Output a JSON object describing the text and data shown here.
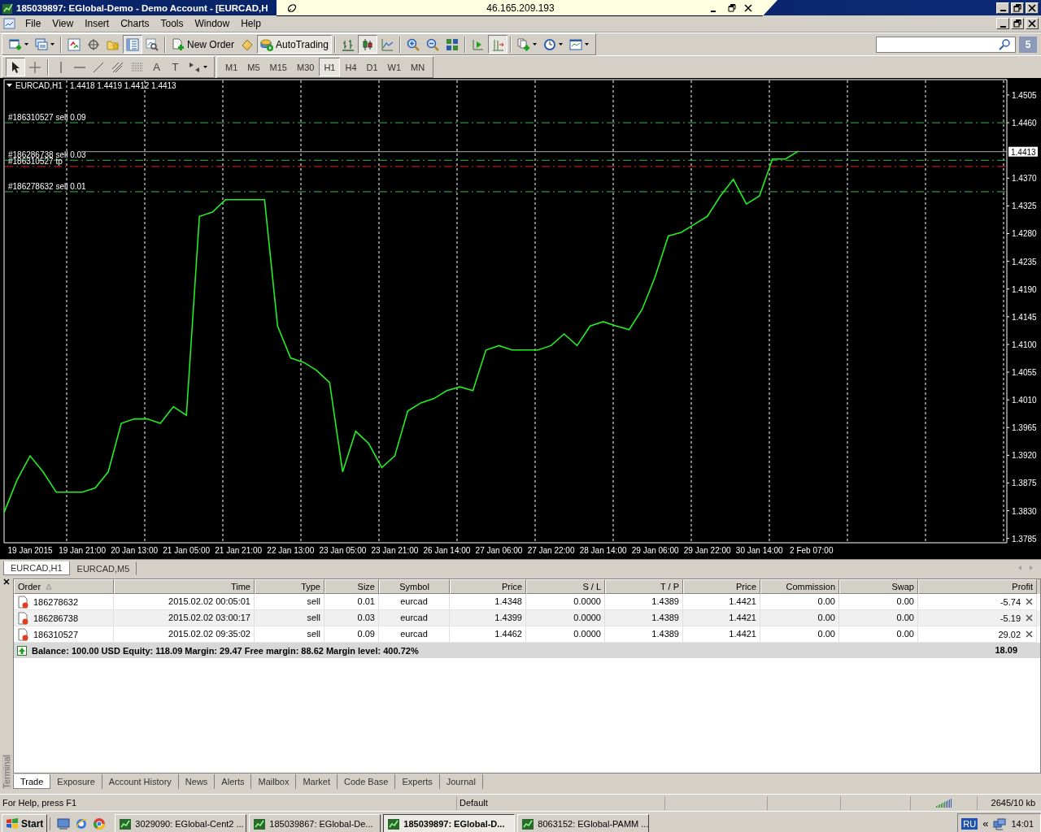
{
  "window": {
    "title": "185039897: EGlobal-Demo - Demo Account - [EURCAD,H"
  },
  "remote_bar": {
    "address": "46.165.209.193"
  },
  "menu": [
    {
      "label": "File"
    },
    {
      "label": "View"
    },
    {
      "label": "Insert"
    },
    {
      "label": "Charts"
    },
    {
      "label": "Tools"
    },
    {
      "label": "Window"
    },
    {
      "label": "Help"
    }
  ],
  "toolbar": [
    {
      "kind": "new-chart",
      "selected": false
    },
    {
      "kind": "profiles",
      "selected": false
    },
    {
      "kind": "separator"
    },
    {
      "kind": "market-watch",
      "selected": false
    },
    {
      "kind": "data-window",
      "selected": false
    },
    {
      "kind": "navigator",
      "selected": false
    },
    {
      "kind": "terminal",
      "selected": true
    },
    {
      "kind": "tester",
      "selected": false
    },
    {
      "kind": "separator"
    },
    {
      "kind": "new-order",
      "label": "New Order",
      "selected": false
    },
    {
      "kind": "metaeditor",
      "selected": false
    },
    {
      "kind": "autotrading",
      "label": "AutoTrading",
      "selected": true
    },
    {
      "kind": "separator"
    },
    {
      "kind": "bar-chart",
      "selected": false
    },
    {
      "kind": "candle-chart",
      "selected": true
    },
    {
      "kind": "line-chart",
      "selected": false
    },
    {
      "kind": "separator"
    },
    {
      "kind": "zoom-in",
      "selected": false
    },
    {
      "kind": "zoom-out",
      "selected": false
    },
    {
      "kind": "tile",
      "selected": false
    },
    {
      "kind": "separator"
    },
    {
      "kind": "autoscroll",
      "selected": false
    },
    {
      "kind": "chart-shift",
      "selected": true
    },
    {
      "kind": "separator"
    },
    {
      "kind": "indicators",
      "selected": false
    },
    {
      "kind": "periods",
      "selected": false
    },
    {
      "kind": "templates",
      "selected": false
    }
  ],
  "messages_badge": "5",
  "drawing_toolbar": [
    {
      "kind": "cursor",
      "selected": true
    },
    {
      "kind": "crosshair",
      "selected": false
    },
    {
      "kind": "separator"
    },
    {
      "kind": "vline",
      "selected": false
    },
    {
      "kind": "hline",
      "selected": false
    },
    {
      "kind": "trendline",
      "selected": false
    },
    {
      "kind": "channel",
      "selected": false
    },
    {
      "kind": "fibo",
      "selected": false
    },
    {
      "kind": "text",
      "label": "A",
      "selected": false
    },
    {
      "kind": "text-label",
      "label": "T",
      "selected": false
    },
    {
      "kind": "arrows",
      "selected": false
    }
  ],
  "timeframes": [
    {
      "label": "M1",
      "selected": false
    },
    {
      "label": "M5",
      "selected": false
    },
    {
      "label": "M15",
      "selected": false
    },
    {
      "label": "M30",
      "selected": false
    },
    {
      "label": "H1",
      "selected": true
    },
    {
      "label": "H4",
      "selected": false
    },
    {
      "label": "D1",
      "selected": false
    },
    {
      "label": "W1",
      "selected": false
    },
    {
      "label": "MN",
      "selected": false
    }
  ],
  "chart": {
    "symbol": "EURCAD,H1",
    "ohlc": "1.4418 1.4419 1.4412 1.4413",
    "price_box": "1.4413",
    "chart_data": {
      "type": "line",
      "categories": [
        null,
        null,
        "19 Jan 2015",
        null,
        null,
        null,
        "19 Jan 21:00",
        null,
        null,
        null,
        "20 Jan 13:00",
        null,
        null,
        null,
        "21 Jan 05:00",
        null,
        null,
        null,
        "21 Jan 21:00",
        null,
        null,
        null,
        "22 Jan 13:00",
        null,
        null,
        null,
        "23 Jan 05:00",
        null,
        null,
        null,
        "23 Jan 21:00",
        null,
        null,
        null,
        "26 Jan 14:00",
        null,
        null,
        null,
        "27 Jan 06:00",
        null,
        null,
        null,
        "27 Jan 22:00",
        null,
        null,
        null,
        "28 Jan 14:00",
        null,
        null,
        null,
        "29 Jan 06:00",
        null,
        null,
        null,
        "29 Jan 22:00",
        null,
        null,
        null,
        "30 Jan 14:00",
        null,
        null,
        null,
        "2 Feb 07:00",
        null,
        null,
        null,
        null,
        null,
        null,
        null,
        null,
        null,
        null,
        null,
        null,
        null,
        null,
        null
      ],
      "series": [
        {
          "color": "#22ee22",
          "values": [
            1.3827,
            1.388,
            1.3919,
            1.3893,
            1.386,
            1.386,
            1.386,
            1.3867,
            1.3893,
            1.3972,
            1.3979,
            1.3979,
            1.3972,
            1.3999,
            1.3985,
            1.4308,
            1.4315,
            1.4335,
            1.4335,
            1.4335,
            1.4335,
            1.413,
            1.4078,
            1.4071,
            1.4058,
            1.4038,
            1.3893,
            1.3959,
            1.3939,
            1.39,
            1.3919,
            1.3992,
            1.4005,
            1.4012,
            1.4025,
            1.4031,
            1.4025,
            1.4091,
            1.4098,
            1.4091,
            1.4091,
            1.4091,
            1.4098,
            1.4117,
            1.4098,
            1.413,
            1.4137,
            1.413,
            1.4124,
            1.4157,
            1.421,
            1.4276,
            1.4282,
            1.4295,
            1.4308,
            1.4341,
            1.4368,
            1.4328,
            1.4341,
            1.4401,
            1.4401,
            1.4414,
            null,
            null,
            null,
            null,
            null,
            null,
            null,
            null,
            null,
            null,
            null,
            null,
            null,
            null,
            null,
            null
          ]
        }
      ],
      "ylim": [
        1.3778,
        1.453
      ],
      "grid": true,
      "yticks": [
        {
          "value": 1.3785,
          "label": "1.3785"
        },
        {
          "value": 1.383,
          "label": "1.3830"
        },
        {
          "value": 1.3875,
          "label": "1.3875"
        },
        {
          "value": 1.392,
          "label": "1.3920"
        },
        {
          "value": 1.3965,
          "label": "1.3965"
        },
        {
          "value": 1.401,
          "label": "1.4010"
        },
        {
          "value": 1.4055,
          "label": "1.4055"
        },
        {
          "value": 1.41,
          "label": "1.4100"
        },
        {
          "value": 1.4145,
          "label": "1.4145"
        },
        {
          "value": 1.419,
          "label": "1.4190"
        },
        {
          "value": 1.4235,
          "label": "1.4235"
        },
        {
          "value": 1.428,
          "label": "1.4280"
        },
        {
          "value": 1.4325,
          "label": "1.4325"
        },
        {
          "value": 1.437,
          "label": "1.4370"
        },
        {
          "value": 1.446,
          "label": "1.4460"
        },
        {
          "value": 1.4505,
          "label": "1.4505"
        }
      ],
      "ref_lines": [
        {
          "axis": "y",
          "value": 1.446,
          "label": "#186310527 sell 0.09",
          "color": "#3cb44b"
        },
        {
          "axis": "y",
          "value": 1.4399,
          "label": "#186286738 sell 0.03",
          "color": "#3cb44b"
        },
        {
          "axis": "y",
          "value": 1.4389,
          "label": "#186310527 tp",
          "color": "#e02020"
        },
        {
          "axis": "y",
          "value": 1.4348,
          "label": "#186278632 sell 0.01",
          "color": "#3cb44b"
        },
        {
          "axis": "y",
          "value": 1.4413,
          "color": "#a8a8a8"
        }
      ]
    }
  },
  "chart_tabs": [
    {
      "label": "EURCAD,H1",
      "selected": true
    },
    {
      "label": "EURCAD,M5",
      "selected": false
    }
  ],
  "terminal": {
    "title": "Terminal",
    "columns": [
      {
        "label": "Order",
        "sorted": true
      },
      {
        "label": "Time",
        "sorted": false
      },
      {
        "label": "Type",
        "sorted": false
      },
      {
        "label": "Size",
        "sorted": false
      },
      {
        "label": "Symbol",
        "sorted": false
      },
      {
        "label": "Price",
        "sorted": false
      },
      {
        "label": "S / L",
        "sorted": false
      },
      {
        "label": "T / P",
        "sorted": false
      },
      {
        "label": "Price",
        "sorted": false
      },
      {
        "label": "Commission",
        "sorted": false
      },
      {
        "label": "Swap",
        "sorted": false
      },
      {
        "label": "Profit",
        "sorted": false
      }
    ],
    "rows": [
      {
        "cells": [
          "186278632",
          "2015.02.02 00:05:01",
          "sell",
          "0.01",
          "eurcad",
          "1.4348",
          "0.0000",
          "1.4389",
          "1.4421",
          "0.00",
          "0.00",
          "-5.74"
        ]
      },
      {
        "cells": [
          "186286738",
          "2015.02.02 03:00:17",
          "sell",
          "0.03",
          "eurcad",
          "1.4399",
          "0.0000",
          "1.4389",
          "1.4421",
          "0.00",
          "0.00",
          "-5.19"
        ]
      },
      {
        "cells": [
          "186310527",
          "2015.02.02 09:35:02",
          "sell",
          "0.09",
          "eurcad",
          "1.4462",
          "0.0000",
          "1.4389",
          "1.4421",
          "0.00",
          "0.00",
          "29.02"
        ]
      }
    ],
    "summary": {
      "text": "Balance: 100.00 USD  Equity: 118.09  Margin: 29.47  Free margin: 88.62  Margin level: 400.72%",
      "profit": "18.09"
    },
    "tabs": [
      {
        "label": "Trade",
        "selected": true
      },
      {
        "label": "Exposure",
        "selected": false
      },
      {
        "label": "Account History",
        "selected": false
      },
      {
        "label": "News",
        "selected": false
      },
      {
        "label": "Alerts",
        "selected": false
      },
      {
        "label": "Mailbox",
        "selected": false
      },
      {
        "label": "Market",
        "selected": false
      },
      {
        "label": "Code Base",
        "selected": false
      },
      {
        "label": "Experts",
        "selected": false
      },
      {
        "label": "Journal",
        "selected": false
      }
    ]
  },
  "status_bar": {
    "help": "For Help, press F1",
    "profile": "Default",
    "traffic": "2645/10 kb"
  },
  "taskbar": {
    "start": "Start",
    "tasks": [
      {
        "label": "3029090: EGlobal-Cent2 ...",
        "selected": false
      },
      {
        "label": "185039867: EGlobal-De...",
        "selected": false
      },
      {
        "label": "185039897: EGlobal-D...",
        "selected": true
      },
      {
        "label": "8063152: EGlobal-PAMM ...",
        "selected": false
      }
    ],
    "tray": {
      "language": "RU",
      "expand": "«",
      "clock": "14:01"
    }
  }
}
